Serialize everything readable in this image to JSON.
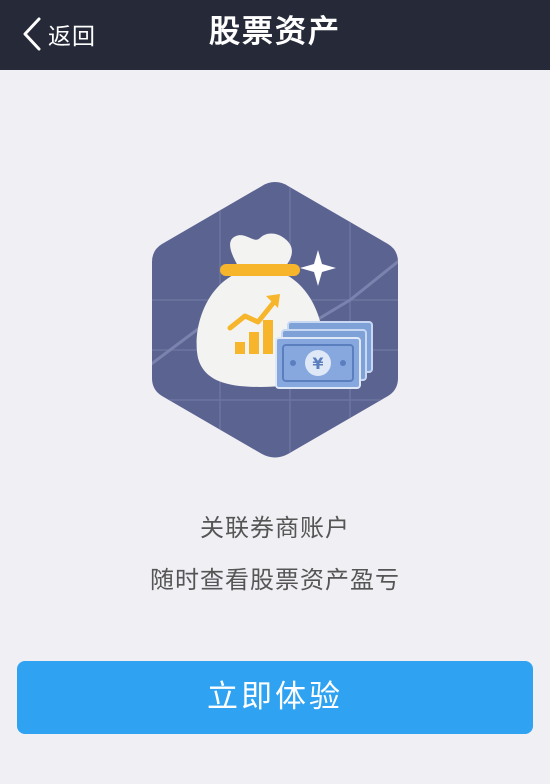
{
  "nav": {
    "back_label": "返回",
    "title": "股票资产"
  },
  "hero": {
    "icon": "money-bag-illustration-icon"
  },
  "content": {
    "line1": "关联券商账户",
    "line2": "随时查看股票资产盈亏"
  },
  "cta": {
    "label": "立即体验"
  },
  "colors": {
    "nav_bg": "#262a38",
    "page_bg": "#efeff4",
    "hex_bg": "#5b6391",
    "accent_blue": "#2fa3f2",
    "gold": "#f6b52a",
    "bill_blue": "#7ea1d8"
  }
}
